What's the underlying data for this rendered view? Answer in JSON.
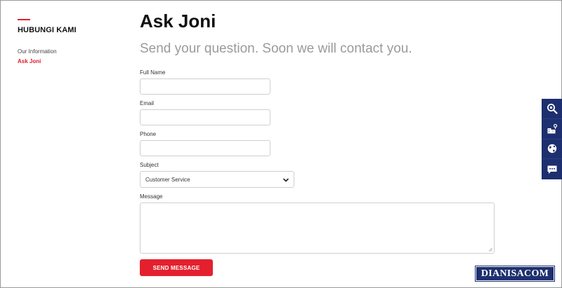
{
  "sidebar": {
    "heading": "HUBUNGI KAMI",
    "items": [
      {
        "label": "Our Information",
        "active": false
      },
      {
        "label": "Ask Joni",
        "active": true
      }
    ]
  },
  "main": {
    "title": "Ask Joni",
    "subtitle": "Send your question. Soon we will contact you."
  },
  "form": {
    "full_name": {
      "label": "Full Name",
      "value": "",
      "placeholder": ""
    },
    "email": {
      "label": "Email",
      "value": "",
      "placeholder": ""
    },
    "phone": {
      "label": "Phone",
      "value": "",
      "placeholder": ""
    },
    "subject": {
      "label": "Subject",
      "selected": "Customer Service"
    },
    "message": {
      "label": "Message",
      "value": ""
    },
    "submit_label": "SEND MESSAGE"
  },
  "floating_toolbar": {
    "icons": [
      "search-zoom-icon",
      "buildings-location-icon",
      "globe-chat-icon",
      "chat-bubble-icon"
    ]
  },
  "watermark": "DIANISACOM",
  "colors": {
    "accent": "#e4202e",
    "toolbar": "#1d2f6e",
    "subtitle": "#9a9a9a"
  }
}
